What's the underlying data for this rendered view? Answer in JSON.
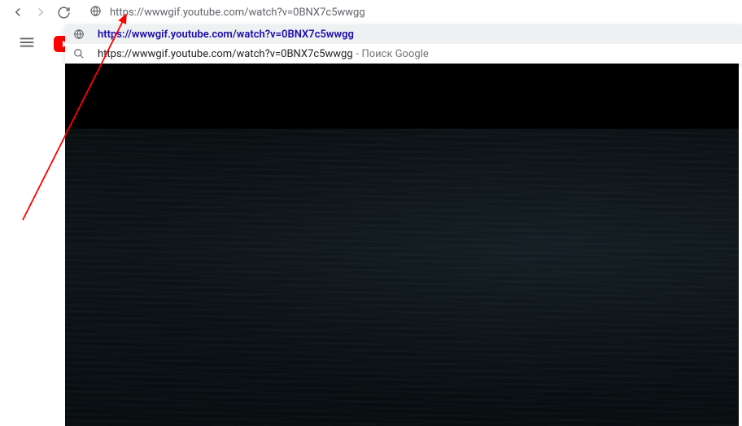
{
  "address_bar": {
    "url": "https://wwwgif.youtube.com/watch?v=0BNX7c5wwgg"
  },
  "suggestions": [
    {
      "type": "globe",
      "text": "https://wwwgif.youtube.com/watch?v=0BNX7c5wwgg",
      "highlighted": true,
      "style": "bold-blue"
    },
    {
      "type": "search",
      "text": "https://wwwgif.youtube.com/watch?v=0BNX7c5wwgg",
      "tail": "- Поиск Google"
    }
  ],
  "annotation": {
    "arrow_color": "#ff0000"
  }
}
